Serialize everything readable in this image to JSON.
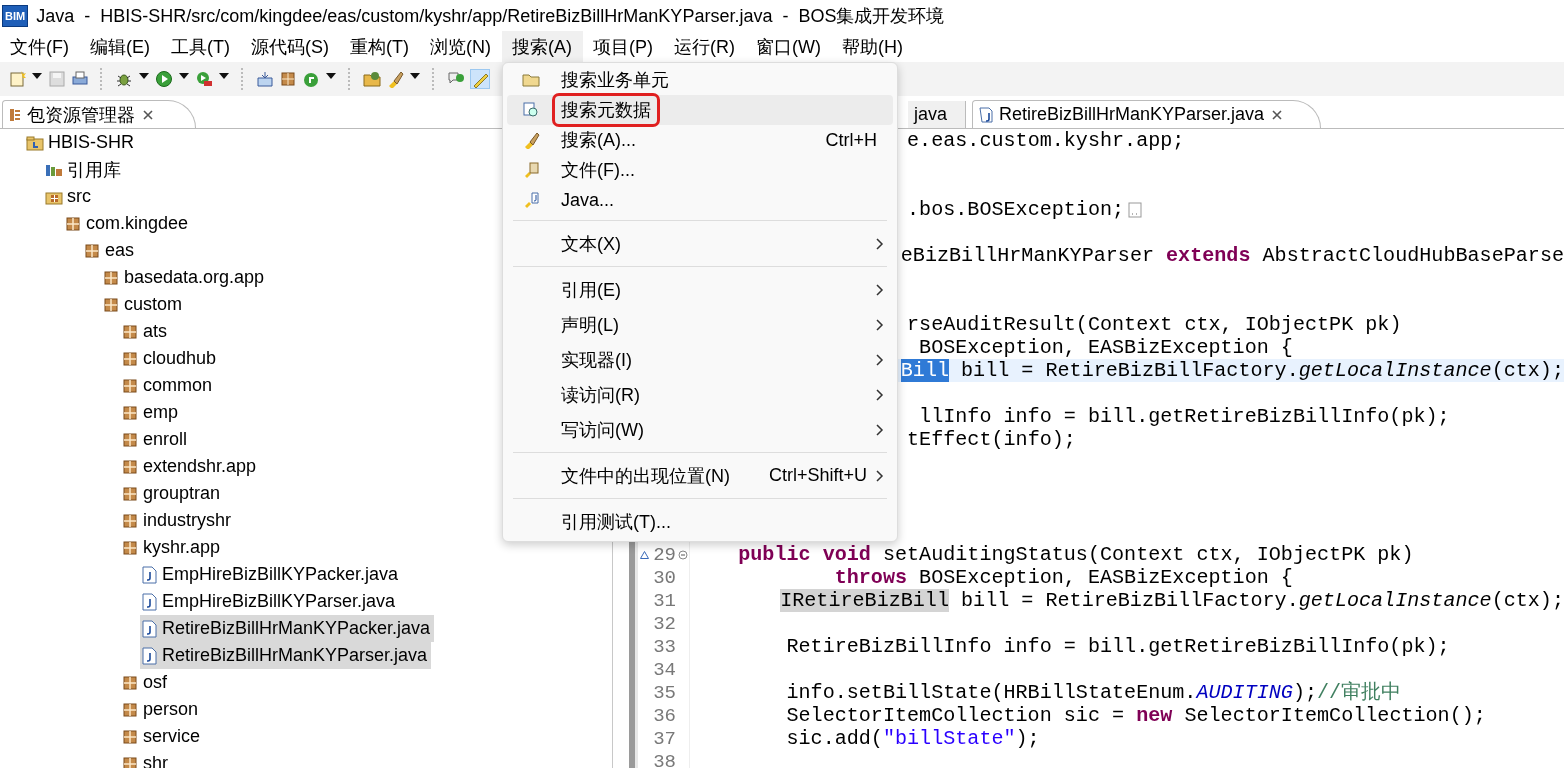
{
  "window": {
    "logo": "BIM",
    "title": "Java  -  HBIS-SHR/src/com/kingdee/eas/custom/kyshr/app/RetireBizBillHrManKYParser.java  -  BOS集成开发环境"
  },
  "menubar": [
    {
      "label": "文件(F)",
      "selected": false
    },
    {
      "label": "编辑(E)",
      "selected": false
    },
    {
      "label": "工具(T)",
      "selected": false
    },
    {
      "label": "源代码(S)",
      "selected": false
    },
    {
      "label": "重构(T)",
      "selected": false
    },
    {
      "label": "浏览(N)",
      "selected": false
    },
    {
      "label": "搜索(A)",
      "selected": true
    },
    {
      "label": "项目(P)",
      "selected": false
    },
    {
      "label": "运行(R)",
      "selected": false
    },
    {
      "label": "窗口(W)",
      "selected": false
    },
    {
      "label": "帮助(H)",
      "selected": false
    }
  ],
  "search_menu": [
    {
      "kind": "item",
      "label": "搜索业务单元",
      "selected": false,
      "outlined": false
    },
    {
      "kind": "item",
      "label": "搜索元数据",
      "selected": true,
      "outlined": true
    },
    {
      "kind": "item",
      "label": "搜索(A)...",
      "shortcut": "Ctrl+H",
      "selected": false,
      "outlined": false
    },
    {
      "kind": "item",
      "label": "文件(F)...",
      "selected": false,
      "outlined": false
    },
    {
      "kind": "item",
      "label": "Java...",
      "selected": false,
      "outlined": false
    },
    {
      "kind": "separator"
    },
    {
      "kind": "submenu",
      "label": "文本(X)",
      "selected": false,
      "outlined": false
    },
    {
      "kind": "separator"
    },
    {
      "kind": "submenu",
      "label": "引用(E)",
      "selected": false,
      "outlined": false
    },
    {
      "kind": "submenu",
      "label": "声明(L)",
      "selected": false,
      "outlined": false
    },
    {
      "kind": "submenu",
      "label": "实现器(I)",
      "selected": false,
      "outlined": false
    },
    {
      "kind": "submenu",
      "label": "读访问(R)",
      "selected": false,
      "outlined": false
    },
    {
      "kind": "submenu",
      "label": "写访问(W)",
      "selected": false,
      "outlined": false
    },
    {
      "kind": "separator"
    },
    {
      "kind": "submenu",
      "label": "文件中的出现位置(N)",
      "shortcut": "Ctrl+Shift+U",
      "selected": false,
      "outlined": false
    },
    {
      "kind": "separator"
    },
    {
      "kind": "item",
      "label": "引用测试(T)...",
      "selected": false,
      "outlined": false
    }
  ],
  "explorer": {
    "tab": {
      "label": "包资源管理器",
      "selected": true
    },
    "tree": [
      {
        "label": "HBIS-SHR",
        "kind": "project",
        "selected": false,
        "children": [
          {
            "label": "引用库",
            "kind": "library",
            "selected": false
          },
          {
            "label": "src",
            "kind": "source",
            "selected": false,
            "children": [
              {
                "label": "com.kingdee",
                "kind": "package",
                "selected": false,
                "children": [
                  {
                    "label": "eas",
                    "kind": "package",
                    "selected": false,
                    "children": [
                      {
                        "label": "basedata.org.app",
                        "kind": "package",
                        "selected": false
                      },
                      {
                        "label": "custom",
                        "kind": "package",
                        "selected": false,
                        "children": [
                          {
                            "label": "ats",
                            "kind": "package",
                            "selected": false
                          },
                          {
                            "label": "cloudhub",
                            "kind": "package",
                            "selected": false
                          },
                          {
                            "label": "common",
                            "kind": "package",
                            "selected": false
                          },
                          {
                            "label": "emp",
                            "kind": "package",
                            "selected": false
                          },
                          {
                            "label": "enroll",
                            "kind": "package",
                            "selected": false
                          },
                          {
                            "label": "extendshr.app",
                            "kind": "package",
                            "selected": false
                          },
                          {
                            "label": "grouptran",
                            "kind": "package",
                            "selected": false
                          },
                          {
                            "label": "industryshr",
                            "kind": "package",
                            "selected": false
                          },
                          {
                            "label": "kyshr.app",
                            "kind": "package",
                            "selected": false,
                            "children": [
                              {
                                "label": "EmpHireBizBillKYPacker.java",
                                "kind": "java",
                                "selected": false
                              },
                              {
                                "label": "EmpHireBizBillKYParser.java",
                                "kind": "java",
                                "selected": false
                              },
                              {
                                "label": "RetireBizBillHrManKYPacker.java",
                                "kind": "java",
                                "selected": true
                              },
                              {
                                "label": "RetireBizBillHrManKYParser.java",
                                "kind": "java",
                                "selected": true
                              }
                            ]
                          },
                          {
                            "label": "osf",
                            "kind": "package",
                            "selected": false
                          },
                          {
                            "label": "person",
                            "kind": "package",
                            "selected": false
                          },
                          {
                            "label": "service",
                            "kind": "package",
                            "selected": false
                          },
                          {
                            "label": "shr",
                            "kind": "package",
                            "selected": false
                          }
                        ]
                      }
                    ]
                  }
                ]
              }
            ]
          }
        ]
      }
    ]
  },
  "editor": {
    "tabs": [
      {
        "label": "java",
        "selected": false
      },
      {
        "label": "RetireBizBillHrManKYParser.java",
        "selected": true
      }
    ],
    "lines": [
      {
        "kind": "code",
        "segments": [
          {
            "text": "                  e.eas.custom.kyshr.app;",
            "kind": "plain"
          }
        ]
      },
      {
        "kind": "blank"
      },
      {
        "kind": "blank"
      },
      {
        "kind": "code",
        "collapsed": true,
        "segments": [
          {
            "text": "                  .bos.BOSException;",
            "kind": "plain"
          }
        ]
      },
      {
        "kind": "blank"
      },
      {
        "kind": "code",
        "segments": [
          {
            "text": "                  eBizBillHrManKYParser ",
            "kind": "plain"
          },
          {
            "text": "extends",
            "kind": "keyword"
          },
          {
            "text": " AbstractCloudHubBaseParse",
            "kind": "plain"
          }
        ]
      },
      {
        "kind": "blank"
      },
      {
        "kind": "blank"
      },
      {
        "kind": "code",
        "segments": [
          {
            "text": "                  rseAuditResult(Context ctx, IObjectPK pk)",
            "kind": "plain"
          }
        ]
      },
      {
        "kind": "code",
        "segments": [
          {
            "text": "                   BOSException, EASBizException {",
            "kind": "plain"
          }
        ]
      },
      {
        "kind": "code",
        "current": true,
        "segments": [
          {
            "text": "                  Bill",
            "kind": "selection"
          },
          {
            "text": " bill = RetireBizBillFactory.",
            "kind": "plain"
          },
          {
            "text": "getLocalInstance",
            "kind": "method"
          },
          {
            "text": "(ctx);",
            "kind": "plain"
          }
        ]
      },
      {
        "kind": "blank"
      },
      {
        "kind": "code",
        "segments": [
          {
            "text": "                   llInfo info = bill.getRetireBizBillInfo(pk);",
            "kind": "plain"
          }
        ]
      },
      {
        "kind": "code",
        "segments": [
          {
            "text": "                  tEffect(info);",
            "kind": "plain"
          }
        ]
      },
      {
        "kind": "blank"
      },
      {
        "kind": "blank"
      },
      {
        "kind": "blank"
      },
      {
        "kind": "blank"
      },
      {
        "kind": "code",
        "number": "29",
        "overrides": true,
        "fold_expanded": true,
        "segments": [
          {
            "text": "    public void",
            "kind": "keyword"
          },
          {
            "text": " setAuditingStatus(Context ctx, IObjectPK pk)",
            "kind": "plain"
          }
        ]
      },
      {
        "kind": "code",
        "number": "30",
        "segments": [
          {
            "text": "            throws",
            "kind": "keyword"
          },
          {
            "text": " BOSException, EASBizException {",
            "kind": "plain"
          }
        ]
      },
      {
        "kind": "code",
        "number": "31",
        "segments": [
          {
            "text": "        IRetireBizBill",
            "kind": "occurrence"
          },
          {
            "text": " bill = RetireBizBillFactory.",
            "kind": "plain"
          },
          {
            "text": "getLocalInstance",
            "kind": "method"
          },
          {
            "text": "(ctx);",
            "kind": "plain"
          }
        ]
      },
      {
        "kind": "blank",
        "number": "32"
      },
      {
        "kind": "code",
        "number": "33",
        "segments": [
          {
            "text": "        RetireBizBillInfo info = bill.getRetireBizBillInfo(pk);",
            "kind": "plain"
          }
        ]
      },
      {
        "kind": "blank",
        "number": "34"
      },
      {
        "kind": "code",
        "number": "35",
        "segments": [
          {
            "text": "        info.setBillState(HRBillStateEnum.",
            "kind": "plain"
          },
          {
            "text": "AUDITING",
            "kind": "constant"
          },
          {
            "text": ");",
            "kind": "plain"
          },
          {
            "text": "//审批中",
            "kind": "comment"
          }
        ]
      },
      {
        "kind": "code",
        "number": "36",
        "segments": [
          {
            "text": "        SelectorItemCollection sic = ",
            "kind": "plain"
          },
          {
            "text": "new",
            "kind": "keyword"
          },
          {
            "text": " SelectorItemCollection();",
            "kind": "plain"
          }
        ]
      },
      {
        "kind": "code",
        "number": "37",
        "segments": [
          {
            "text": "        sic.add(",
            "kind": "plain"
          },
          {
            "text": "\"billState\"",
            "kind": "string"
          },
          {
            "text": ");",
            "kind": "plain"
          }
        ]
      },
      {
        "kind": "blank",
        "number": "38"
      }
    ]
  }
}
